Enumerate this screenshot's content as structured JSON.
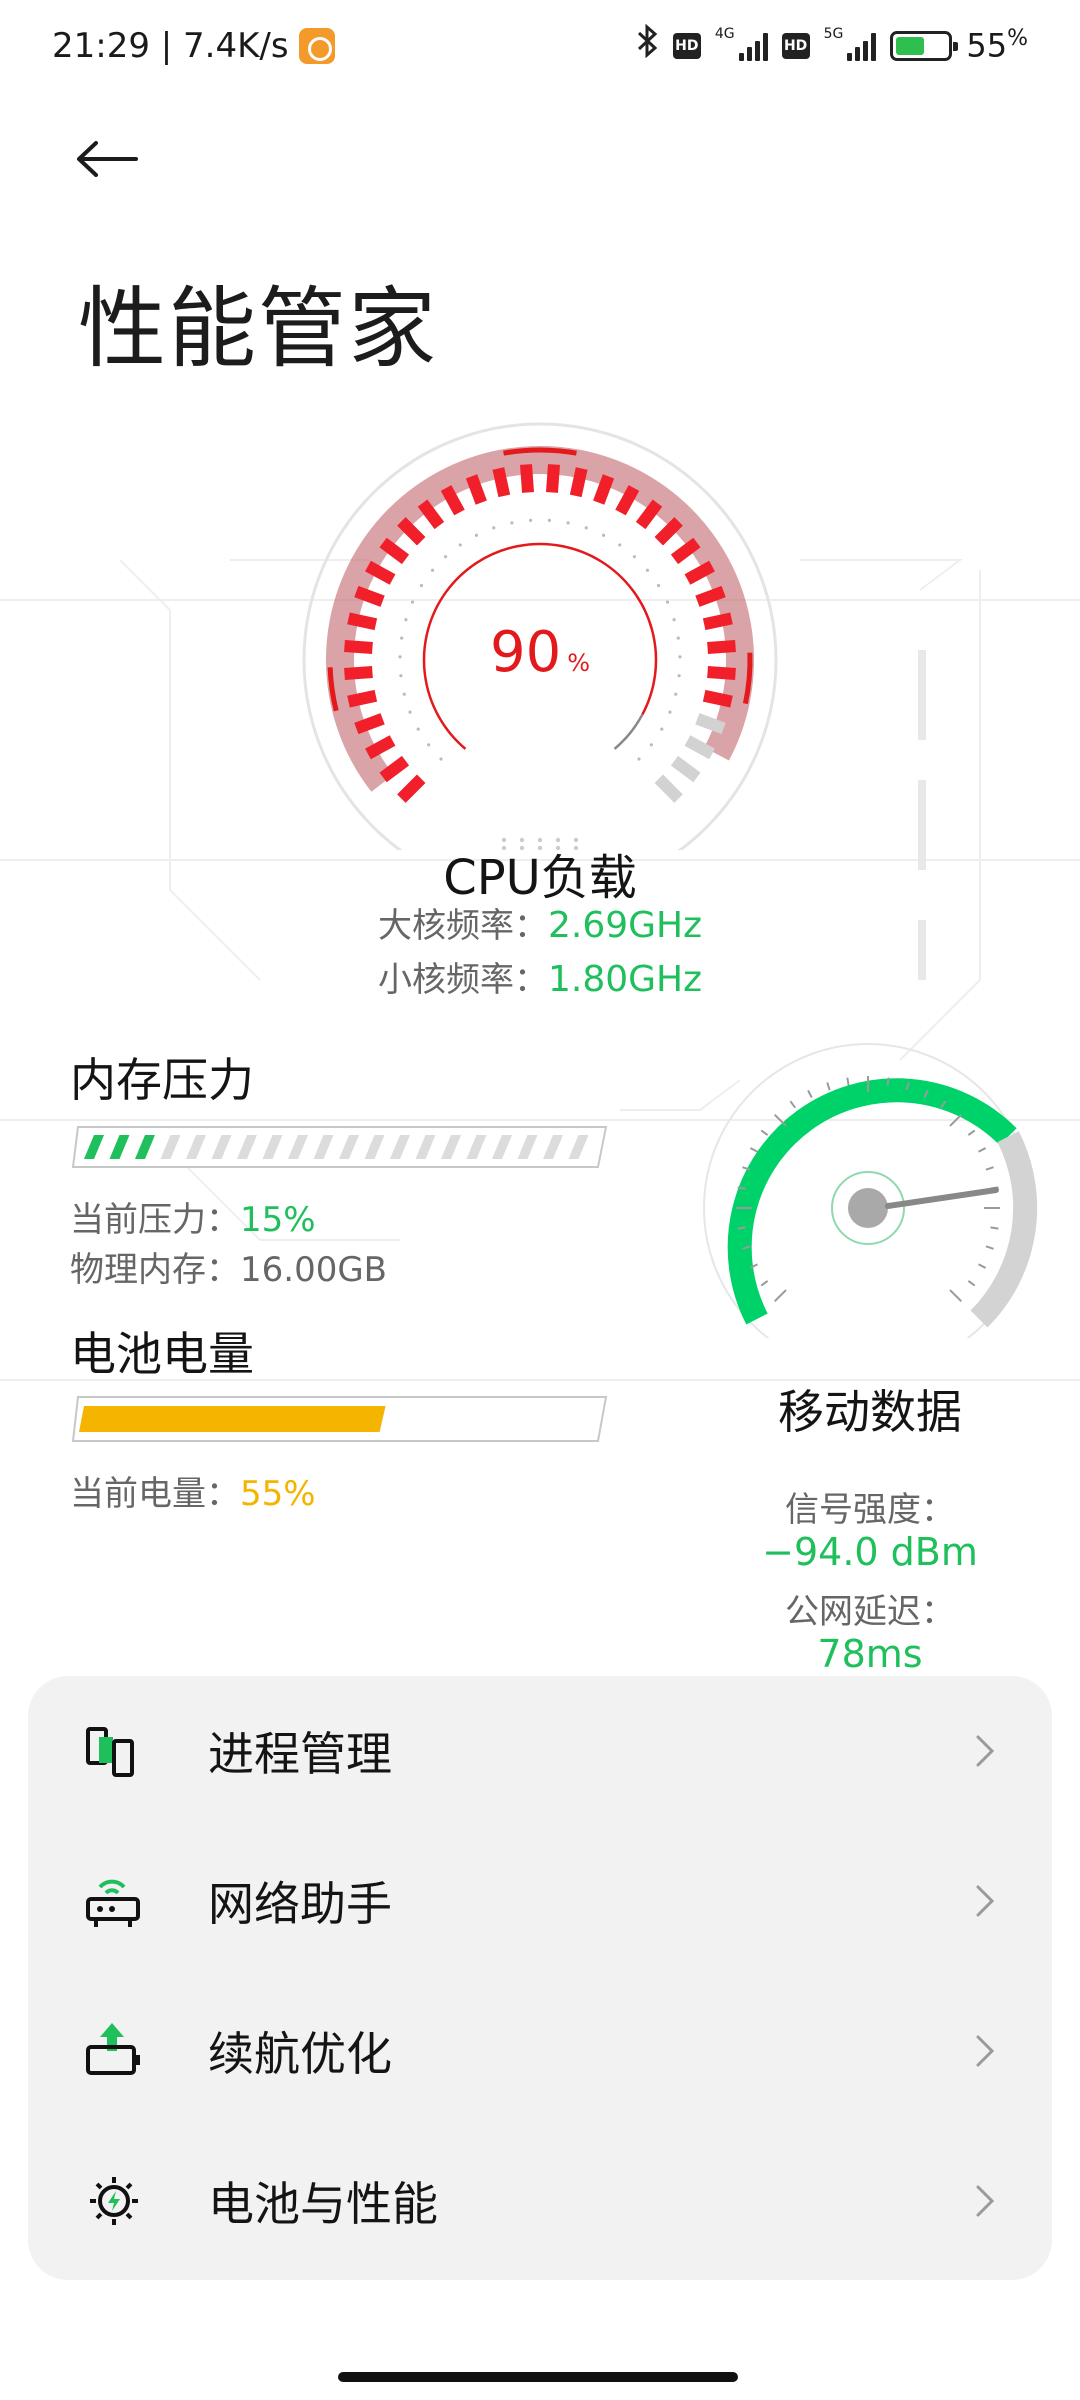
{
  "status_bar": {
    "time_speed": "21:29 | 7.4K/s",
    "net_type_1": "4G",
    "net_type_2": "5G",
    "hd_label": "HD",
    "battery_percent": "55",
    "battery_percent_symbol": "%",
    "battery_level": 0.55
  },
  "header": {
    "back_icon": "arrow-left-icon",
    "title": "性能管家"
  },
  "cpu": {
    "value": "90",
    "unit": "%",
    "load_fraction": 0.9,
    "label": "CPU负载",
    "big_core_label": "大核频率：",
    "big_core_value": "2.69GHz",
    "little_core_label": "小核频率：",
    "little_core_value": "1.80GHz"
  },
  "memory": {
    "title": "内存压力",
    "pressure_label": "当前压力：",
    "pressure_value": "15%",
    "pressure_fraction": 0.15,
    "physical_label": "物理内存：",
    "physical_value": "16.00GB"
  },
  "battery": {
    "title": "电池电量",
    "level_label": "当前电量：",
    "level_value": "55%",
    "level_fraction": 0.55
  },
  "mobile": {
    "title": "移动数据",
    "signal_label": "信号强度：",
    "signal_value": "−94.0 dBm",
    "latency_label": "公网延迟：",
    "latency_value": "78ms"
  },
  "menu": [
    {
      "label": "进程管理",
      "icon": "process-icon"
    },
    {
      "label": "网络助手",
      "icon": "router-icon"
    },
    {
      "label": "续航优化",
      "icon": "battery-boost-icon"
    },
    {
      "label": "电池与性能",
      "icon": "gear-icon"
    }
  ],
  "colors": {
    "accent_green": "#1fbf5c",
    "cpu_red": "#e3191c",
    "battery_yellow": "#f4b400"
  }
}
